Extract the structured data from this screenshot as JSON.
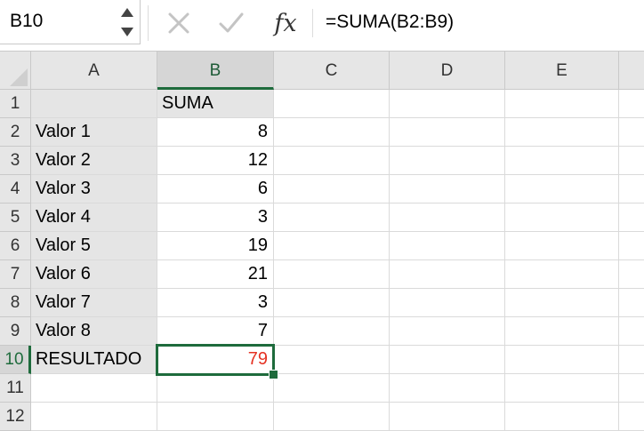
{
  "formula_bar": {
    "name_box": "B10",
    "fx_label": "fx",
    "formula": "=SUMA(B2:B9)"
  },
  "columns": [
    "A",
    "B",
    "C",
    "D",
    "E"
  ],
  "rows": [
    "1",
    "2",
    "3",
    "4",
    "5",
    "6",
    "7",
    "8",
    "9",
    "10",
    "11",
    "12"
  ],
  "cells": {
    "B1": "SUMA",
    "A2": "Valor 1",
    "B2": "8",
    "A3": "Valor 2",
    "B3": "12",
    "A4": "Valor 3",
    "B4": "6",
    "A5": "Valor 4",
    "B5": "3",
    "A6": "Valor 5",
    "B6": "19",
    "A7": "Valor 6",
    "B7": "21",
    "A8": "Valor 7",
    "B8": "3",
    "A9": "Valor 8",
    "B9": "7",
    "A10": "RESULTADO",
    "B10": "79"
  },
  "selected_cell": "B10",
  "colors": {
    "accent": "#1e6b3c",
    "result_value": "#e53223",
    "shaded_cells": "#e5e5e5"
  },
  "icons": [
    "chevron-up-icon",
    "chevron-down-icon",
    "cancel-icon",
    "enter-icon",
    "fx-icon",
    "select-all-icon"
  ]
}
